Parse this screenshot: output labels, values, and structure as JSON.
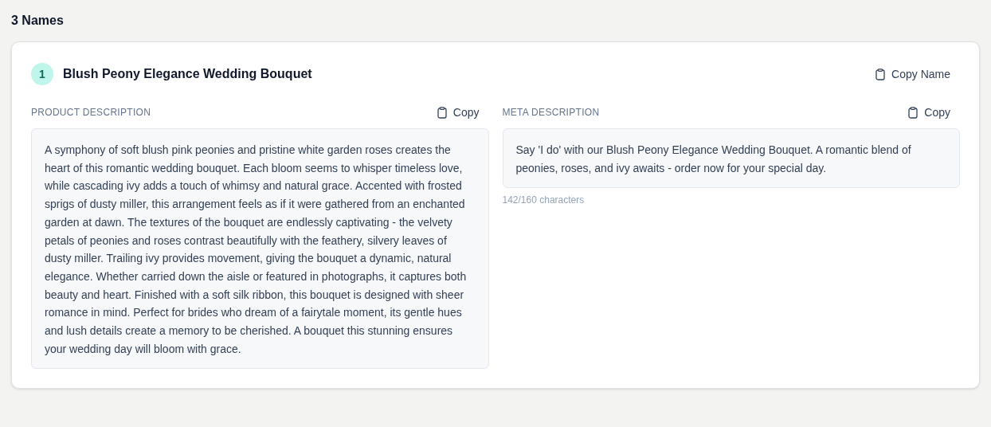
{
  "heading": "3 Names",
  "card": {
    "number": "1",
    "title": "Blush Peony Elegance Wedding Bouquet",
    "copy_name_button": "Copy Name",
    "sections": [
      {
        "label": "PRODUCT DESCRIPTION",
        "copy_button": "Copy",
        "text": "A symphony of soft blush pink peonies and pristine white garden roses creates the heart of this romantic wedding bouquet. Each bloom seems to whisper timeless love, while cascading ivy adds a touch of whimsy and natural grace. Accented with frosted sprigs of dusty miller, this arrangement feels as if it were gathered from an enchanted garden at dawn. The textures of the bouquet are endlessly captivating - the velvety petals of peonies and roses contrast beautifully with the feathery, silvery leaves of dusty miller. Trailing ivy provides movement, giving the bouquet a dynamic, natural elegance. Whether carried down the aisle or featured in photographs, it captures both beauty and heart. Finished with a soft silk ribbon, this bouquet is designed with sheer romance in mind. Perfect for brides who dream of a fairytale moment, its gentle hues and lush details create a memory to be cherished. A bouquet this stunning ensures your wedding day will bloom with grace."
      },
      {
        "label": "META DESCRIPTION",
        "copy_button": "Copy",
        "text": "Say 'I do' with our Blush Peony Elegance Wedding Bouquet. A romantic blend of peonies, roses, and ivy awaits - order now for your special day.",
        "count": "142/160 characters"
      }
    ]
  }
}
